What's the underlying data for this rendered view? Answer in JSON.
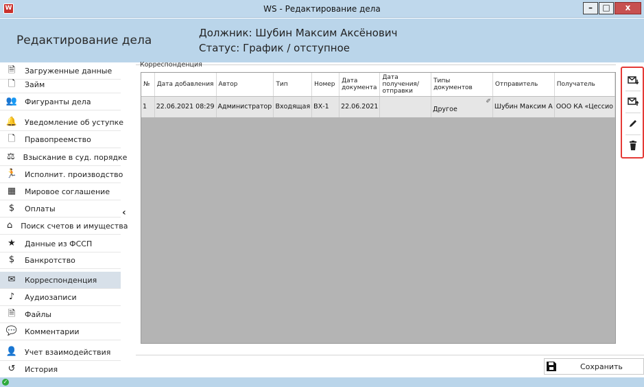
{
  "window": {
    "title": "WS - Редактирование дела",
    "app_icon": "W",
    "controls": {
      "minimize": "–",
      "maximize": "□",
      "close": "x"
    }
  },
  "header": {
    "section_title": "Редактирование дела",
    "debtor": "Должник: Шубин Максим Аксёнович",
    "status": "Статус: График / отступное"
  },
  "sidebar": {
    "collapse_icon": "chevron-left-icon",
    "items": [
      {
        "label": "Загруженные данные",
        "icon": "document-download-icon",
        "glyph": "🗎"
      },
      {
        "label": "Займ",
        "icon": "document-icon",
        "glyph": "🗋"
      },
      {
        "label": "Фигуранты дела",
        "icon": "people-icon",
        "glyph": "👥"
      },
      {
        "label": "Уведомление об уступке",
        "icon": "bell-icon",
        "glyph": "🔔"
      },
      {
        "label": "Правопреемство",
        "icon": "document-search-icon",
        "glyph": "🗋"
      },
      {
        "label": "Взыскание в суд. порядке",
        "icon": "court-icon",
        "glyph": "⚖"
      },
      {
        "label": "Исполнит. производство",
        "icon": "runner-icon",
        "glyph": "🏃"
      },
      {
        "label": "Мировое соглашение",
        "icon": "calendar-icon",
        "glyph": "▦"
      },
      {
        "label": "Оплаты",
        "icon": "dollar-icon",
        "glyph": "$"
      },
      {
        "label": "Поиск счетов и имущества",
        "icon": "house-search-icon",
        "glyph": "⌂"
      },
      {
        "label": "Данные из ФССП",
        "icon": "badge-icon",
        "glyph": "★"
      },
      {
        "label": "Банкротство",
        "icon": "no-money-icon",
        "glyph": "$"
      },
      {
        "label": "Корреспонденция",
        "icon": "envelope-icon",
        "glyph": "✉"
      },
      {
        "label": "Аудиозаписи",
        "icon": "audio-file-icon",
        "glyph": "♪"
      },
      {
        "label": "Файлы",
        "icon": "file-icon",
        "glyph": "🗎"
      },
      {
        "label": "Комментарии",
        "icon": "comment-icon",
        "glyph": "💬"
      },
      {
        "label": "Учет взаимодействия",
        "icon": "person-voice-icon",
        "glyph": "👤"
      },
      {
        "label": "История",
        "icon": "history-icon",
        "glyph": "↺"
      }
    ],
    "active_index": 12
  },
  "correspondence": {
    "group_label": "Корреспонденция",
    "columns": [
      "№",
      "Дата добавления",
      "Автор",
      "Тип",
      "Номер",
      "Дата документа",
      "Дата получения/ отправки",
      "Типы документов",
      "Отправитель",
      "Получатель"
    ],
    "rows": [
      {
        "num": "1",
        "date_added": "22.06.2021 08:29",
        "author": "Администратор",
        "type": "Входящая",
        "number": "ВХ-1",
        "doc_date": "22.06.2021",
        "sent_date": "",
        "doc_types": "Другое",
        "sender": "Шубин Максим А",
        "recipient": "ООО КА «Цессио"
      }
    ]
  },
  "toolbar": {
    "buttons": [
      {
        "name": "incoming-mail-button",
        "icon": "mail-incoming-icon"
      },
      {
        "name": "outgoing-mail-button",
        "icon": "mail-outgoing-icon"
      },
      {
        "name": "edit-button",
        "icon": "pencil-icon"
      },
      {
        "name": "delete-button",
        "icon": "trash-icon"
      }
    ],
    "highlight_color": "#e53935"
  },
  "footer": {
    "save_label": "Сохранить",
    "save_icon": "floppy-disk-icon",
    "status_icon": "check-icon",
    "status_color": "#2eaa3c"
  }
}
